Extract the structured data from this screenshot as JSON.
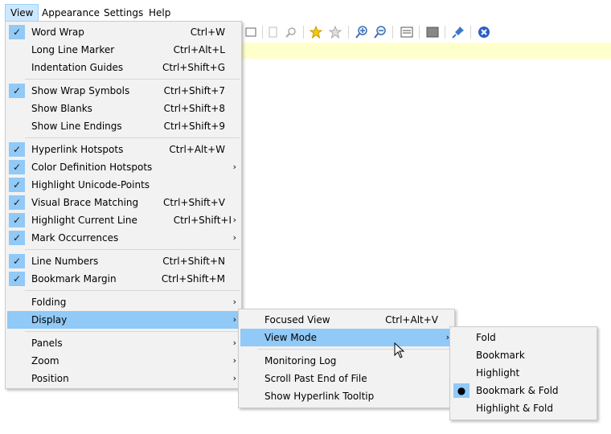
{
  "menubar": [
    "View",
    "Appearance",
    "Settings",
    "Help"
  ],
  "view_menu": {
    "items": [
      {
        "label": "Word Wrap",
        "shortcut": "Ctrl+W",
        "checked": true
      },
      {
        "label": "Long Line Marker",
        "shortcut": "Ctrl+Alt+L",
        "checked": false
      },
      {
        "label": "Indentation Guides",
        "shortcut": "Ctrl+Shift+G",
        "checked": false
      },
      {
        "label": "Show Wrap Symbols",
        "shortcut": "Ctrl+Shift+7",
        "checked": true
      },
      {
        "label": "Show Blanks",
        "shortcut": "Ctrl+Shift+8",
        "checked": false
      },
      {
        "label": "Show Line Endings",
        "shortcut": "Ctrl+Shift+9",
        "checked": false
      },
      {
        "label": "Hyperlink Hotspots",
        "shortcut": "Ctrl+Alt+W",
        "checked": true
      },
      {
        "label": "Color Definition Hotspots",
        "shortcut": "",
        "checked": true,
        "submenu": true
      },
      {
        "label": "Highlight Unicode-Points",
        "shortcut": "",
        "checked": true
      },
      {
        "label": "Visual Brace Matching",
        "shortcut": "Ctrl+Shift+V",
        "checked": true
      },
      {
        "label": "Highlight Current Line",
        "shortcut": "Ctrl+Shift+I",
        "checked": true,
        "submenu": true
      },
      {
        "label": "Mark Occurrences",
        "shortcut": "",
        "checked": true,
        "submenu": true
      },
      {
        "label": "Line Numbers",
        "shortcut": "Ctrl+Shift+N",
        "checked": true
      },
      {
        "label": "Bookmark Margin",
        "shortcut": "Ctrl+Shift+M",
        "checked": true
      },
      {
        "label": "Folding",
        "submenu": true
      },
      {
        "label": "Display",
        "submenu": true,
        "highlighted": true
      },
      {
        "label": "Panels",
        "submenu": true
      },
      {
        "label": "Zoom",
        "submenu": true
      },
      {
        "label": "Position",
        "submenu": true
      }
    ]
  },
  "display_menu": {
    "items": [
      {
        "label": "Focused View",
        "shortcut": "Ctrl+Alt+V"
      },
      {
        "label": "View Mode",
        "submenu": true,
        "highlighted": true
      },
      {
        "label": "Monitoring Log"
      },
      {
        "label": "Scroll Past End of File"
      },
      {
        "label": "Show Hyperlink Tooltip"
      }
    ]
  },
  "viewmode_menu": {
    "items": [
      {
        "label": "Fold"
      },
      {
        "label": "Bookmark"
      },
      {
        "label": "Highlight"
      },
      {
        "label": "Bookmark & Fold",
        "selected": true
      },
      {
        "label": "Highlight & Fold"
      }
    ]
  },
  "glyphs": {
    "check": "✓",
    "arrow": "›",
    "bullet": "●"
  },
  "toolbar_icons": [
    "dim-doc-icon",
    "zoom-find-icon",
    "star-icon",
    "star-outline-icon",
    "zoom-in-icon",
    "zoom-out-icon",
    "panel-icon",
    "screen-icon",
    "pin-icon",
    "close-circle-icon"
  ],
  "colors": {
    "highlight": "#91c9f7",
    "menu_bg": "#f2f2f2",
    "current_line": "#ffffcc"
  }
}
